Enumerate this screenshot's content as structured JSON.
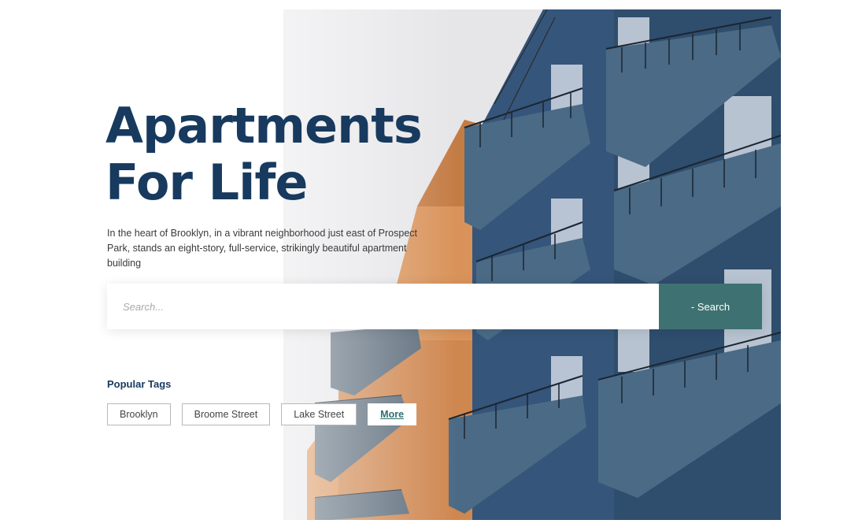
{
  "hero": {
    "title_line1": "Apartments",
    "title_line2": "For Life",
    "subtitle": "In the heart of Brooklyn, in a vibrant neighborhood just east of Prospect Park, stands an eight-story, full-service, strikingly beautiful apartment building"
  },
  "search": {
    "placeholder": "Search...",
    "button_label": "- Search"
  },
  "tags": {
    "heading": "Popular Tags",
    "items": [
      "Brooklyn",
      "Broome Street",
      "Lake Street"
    ],
    "more_label": "More"
  },
  "colors": {
    "title": "#173a5e",
    "accent": "#3e7272",
    "building_blue": "#2f4d6d",
    "building_orange": "#d9935a"
  }
}
